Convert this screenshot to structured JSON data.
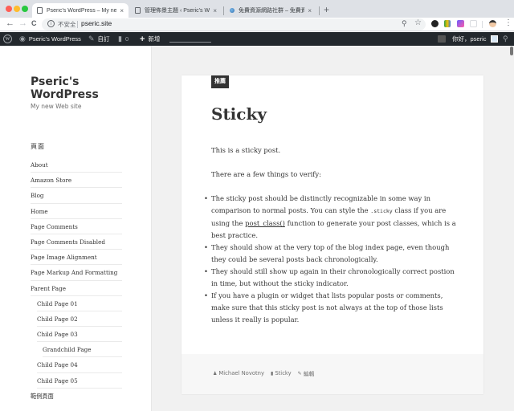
{
  "browser": {
    "tabs": [
      {
        "label": "Pseric's WordPress – My new Web site",
        "active": true
      },
      {
        "label": "管理佈景主題 ‹ Pseric's WordPress",
        "active": false
      },
      {
        "label": "免費資源網路社群 – 免費資源指南",
        "active": false
      }
    ],
    "close_glyph": "×",
    "new_tab_glyph": "+",
    "back_glyph": "←",
    "forward_glyph": "→",
    "reload_glyph": "C",
    "security_label": "不安全",
    "info_glyph": "i",
    "url": "pseric.site",
    "menu_glyph": "⋮"
  },
  "adminbar": {
    "site_name": "Pseric's WordPress",
    "customize": "自訂",
    "comments_count": "0",
    "new": "新增",
    "greeting": "你好，pseric"
  },
  "sidebar": {
    "site_title": "Pseric's WordPress",
    "site_description": "My new Web site",
    "widget_title": "頁面",
    "pages": [
      {
        "label": "About",
        "level": 0
      },
      {
        "label": "Amazon Store",
        "level": 0
      },
      {
        "label": "Blog",
        "level": 0
      },
      {
        "label": "Home",
        "level": 0
      },
      {
        "label": "Page Comments",
        "level": 0
      },
      {
        "label": "Page Comments Disabled",
        "level": 0
      },
      {
        "label": "Page Image Alignment",
        "level": 0
      },
      {
        "label": "Page Markup And Formatting",
        "level": 0
      },
      {
        "label": "Parent Page",
        "level": 0
      },
      {
        "label": "Child Page 01",
        "level": 1
      },
      {
        "label": "Child Page 02",
        "level": 1
      },
      {
        "label": "Child Page 03",
        "level": 1
      },
      {
        "label": "Grandchild Page",
        "level": 2
      },
      {
        "label": "Child Page 04",
        "level": 1
      },
      {
        "label": "Child Page 05",
        "level": 1
      },
      {
        "label": "範例頁面",
        "level": 0
      }
    ]
  },
  "post": {
    "badge": "推薦",
    "title": "Sticky",
    "para1": "This is a sticky post.",
    "para2": "There are a few things to verify:",
    "bullets": {
      "b1_a": "The sticky post should be distinctly recognizable in some way in comparison to normal posts. You can style the ",
      "b1_code": ".sticky",
      "b1_b": " class if you are using the ",
      "b1_link": "post_class()",
      "b1_c": " function to generate your post classes, which is a best practice.",
      "b2": "They should show at the very top of the blog index page, even though they could be several posts back chronologically.",
      "b3": "They should still show up again in their chronologically correct postion in time, but without the sticky indicator.",
      "b4": "If you have a plugin or widget that lists popular posts or comments, make sure that this sticky post is not always at the top of those lists unless it really is popular."
    },
    "meta": {
      "author": "Michael Novotny",
      "category": "Sticky",
      "edit": "編輯"
    }
  }
}
